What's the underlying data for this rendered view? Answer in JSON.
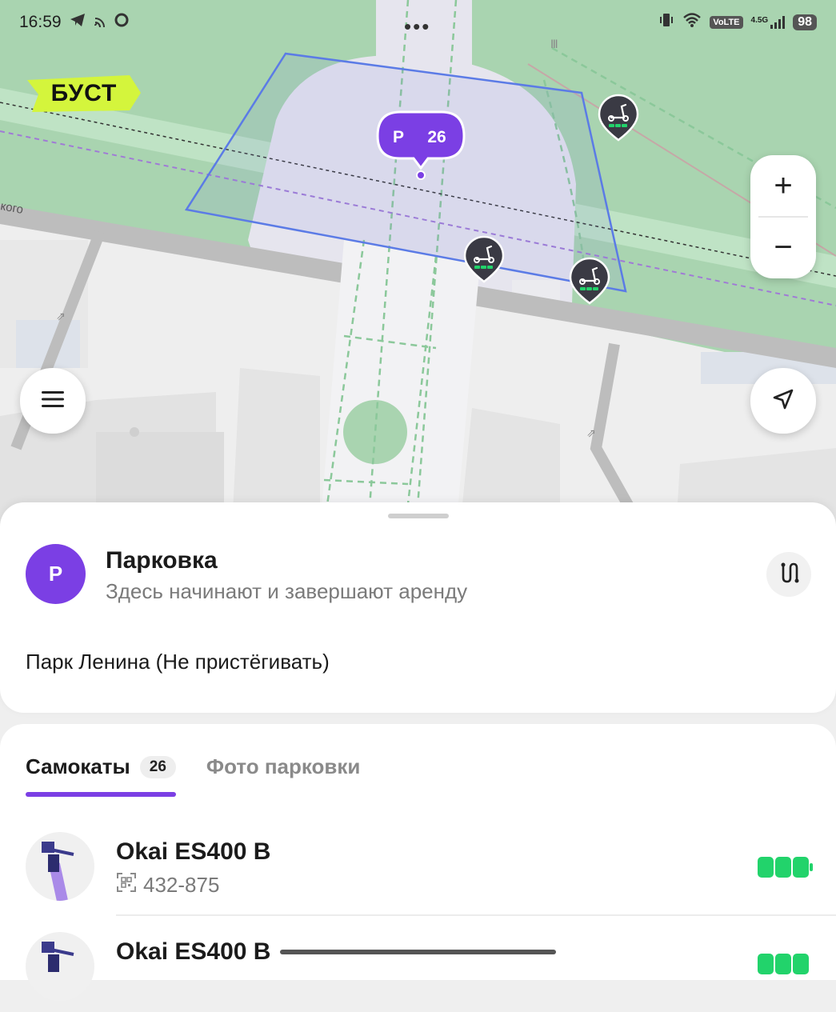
{
  "status_bar": {
    "time": "16:59",
    "left_icons": [
      "telegram-icon",
      "cast-icon",
      "chat-icon"
    ],
    "dots": "•••",
    "volte": "VoLTE",
    "network": "4.5G",
    "battery": "98"
  },
  "map": {
    "logo": "БУСТ",
    "street_label": "кого",
    "parking_marker": {
      "letter": "P",
      "count": "26"
    },
    "zoom_in": "+",
    "zoom_out": "−",
    "scooter_markers": 3,
    "colors": {
      "accent": "#7b3fe4",
      "logo_bg": "#d4f53c",
      "zone_outline": "#5b7be6",
      "battery": "#22d36b"
    }
  },
  "parking_card": {
    "avatar": "P",
    "title": "Парковка",
    "subtitle": "Здесь начинают и завершают аренду",
    "name": "Парк Ленина (Не пристёгивать)"
  },
  "tabs": {
    "active": {
      "label": "Самокаты",
      "count": "26"
    },
    "inactive": {
      "label": "Фото парковки"
    }
  },
  "scooters": [
    {
      "model": "Okai ES400 B",
      "code": "432-875",
      "battery_level": 1.0
    },
    {
      "model": "Okai ES400 B",
      "code": "",
      "battery_level": 1.0
    }
  ]
}
